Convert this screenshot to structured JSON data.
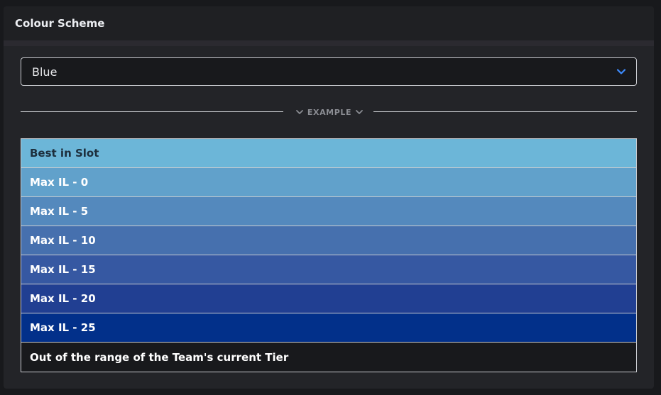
{
  "panel": {
    "title": "Colour Scheme"
  },
  "scheme_select": {
    "value": "Blue",
    "icon": "chevron-down-icon",
    "accent_color": "#3d8bfd"
  },
  "example_divider": {
    "label": "EXAMPLE",
    "icon": "chevron-down-icon"
  },
  "example_rows": [
    {
      "label": "Best in Slot",
      "bg": "#6cb6d8",
      "fg": "#1d2f3d"
    },
    {
      "label": "Max IL - 0",
      "bg": "#61a1cb",
      "fg": "#ffffff"
    },
    {
      "label": "Max IL - 5",
      "bg": "#5489bd",
      "fg": "#ffffff"
    },
    {
      "label": "Max IL - 10",
      "bg": "#4670ae",
      "fg": "#ffffff"
    },
    {
      "label": "Max IL - 15",
      "bg": "#3658a2",
      "fg": "#ffffff"
    },
    {
      "label": "Max IL - 20",
      "bg": "#213f92",
      "fg": "#ffffff"
    },
    {
      "label": "Max IL - 25",
      "bg": "#02308a",
      "fg": "#ffffff"
    },
    {
      "label": "Out of the range of the Team's current Tier",
      "bg": "#18191c",
      "fg": "#ffffff"
    }
  ]
}
